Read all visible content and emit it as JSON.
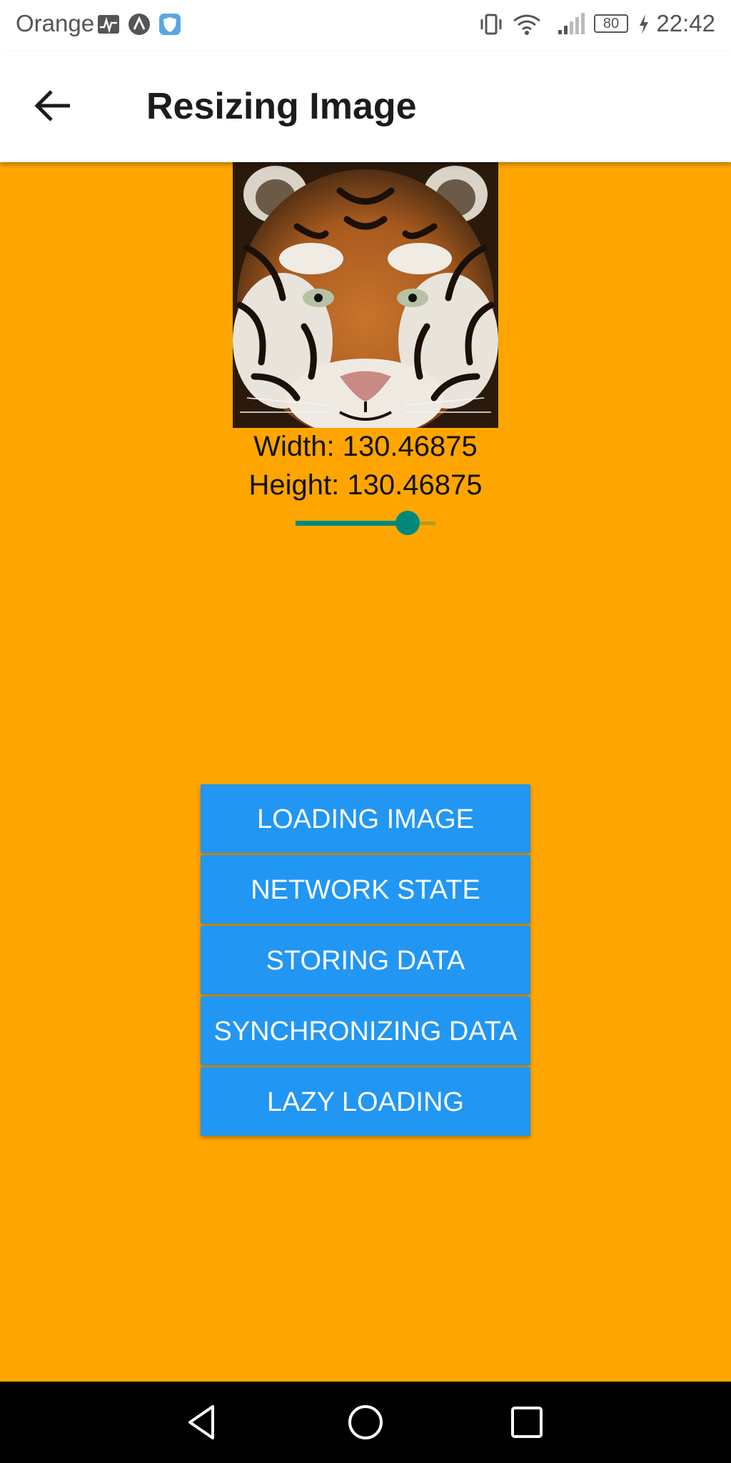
{
  "status_bar": {
    "carrier": "Orange",
    "battery": "80",
    "time": "22:42",
    "icons": [
      "activity-icon",
      "arrow-app-icon",
      "shield-icon",
      "vibrate-icon",
      "wifi-icon",
      "signal-icon",
      "battery-icon",
      "charging-icon"
    ]
  },
  "app_bar": {
    "title": "Resizing Image",
    "back_icon": "arrow-left-icon"
  },
  "image": {
    "subject": "tiger-face-photo"
  },
  "dimensions": {
    "width_text": "Width: 130.46875",
    "height_text": "Height: 130.46875"
  },
  "slider": {
    "value_fraction": 0.8,
    "active_color": "#00897B"
  },
  "buttons": [
    {
      "label": "LOADING IMAGE"
    },
    {
      "label": "NETWORK STATE"
    },
    {
      "label": "STORING DATA"
    },
    {
      "label": "SYNCHRONIZING DATA"
    },
    {
      "label": "LAZY LOADING"
    }
  ],
  "colors": {
    "background": "#FFA500",
    "button": "#2196F3",
    "button_text": "#FFFFFF"
  },
  "nav_bar": {
    "icons": [
      "back-triangle-icon",
      "home-circle-icon",
      "recents-square-icon"
    ]
  }
}
